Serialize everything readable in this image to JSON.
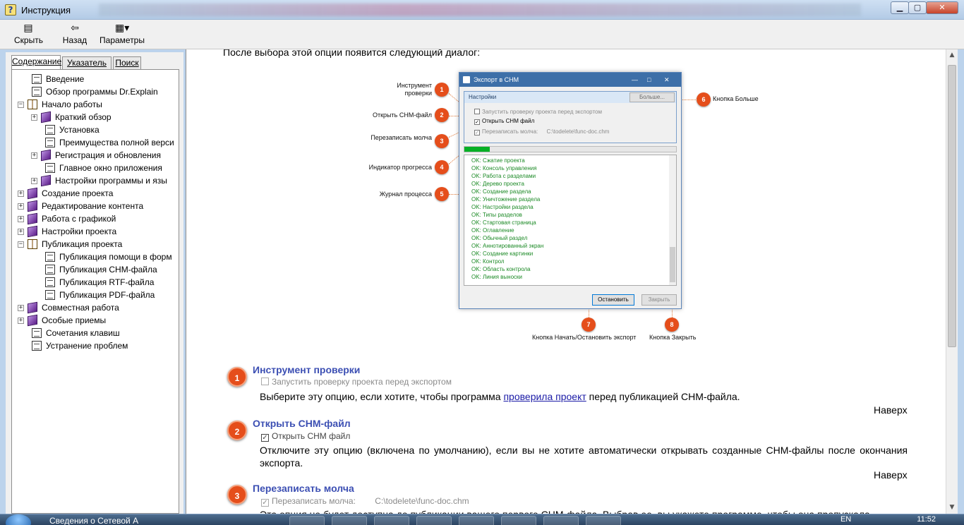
{
  "window": {
    "title": "Инструкция"
  },
  "toolbar": {
    "hide": "Скрыть",
    "back": "Назад",
    "options": "Параметры"
  },
  "tabs": [
    "Содержание",
    "Указатель",
    "Поиск"
  ],
  "tree": [
    {
      "label": "Введение",
      "icon": "page",
      "level": 1,
      "expander": false
    },
    {
      "label": "Обзор программы Dr.Explain",
      "icon": "page",
      "level": 1,
      "expander": false
    },
    {
      "label": "Начало работы",
      "icon": "open-book",
      "level": 0,
      "expander": "−"
    },
    {
      "label": "Краткий обзор",
      "icon": "book",
      "level": 2,
      "expander": "+"
    },
    {
      "label": "Установка",
      "icon": "page",
      "level": 3,
      "expander": false
    },
    {
      "label": "Преимущества полной верси",
      "icon": "page",
      "level": 3,
      "expander": false
    },
    {
      "label": "Регистрация и обновления",
      "icon": "book",
      "level": 2,
      "expander": "+"
    },
    {
      "label": "Главное окно приложения",
      "icon": "page",
      "level": 3,
      "expander": false
    },
    {
      "label": "Настройки программы и язы",
      "icon": "book",
      "level": 2,
      "expander": "+"
    },
    {
      "label": "Создание проекта",
      "icon": "book",
      "level": 0,
      "expander": "+"
    },
    {
      "label": "Редактирование контента",
      "icon": "book",
      "level": 0,
      "expander": "+"
    },
    {
      "label": "Работа с графикой",
      "icon": "book",
      "level": 0,
      "expander": "+"
    },
    {
      "label": "Настройки проекта",
      "icon": "book",
      "level": 0,
      "expander": "+"
    },
    {
      "label": "Публикация проекта",
      "icon": "open-book",
      "level": 0,
      "expander": "−"
    },
    {
      "label": "Публикация помощи в форм",
      "icon": "page",
      "level": 3,
      "expander": false
    },
    {
      "label": "Публикация CHM-файла",
      "icon": "page",
      "level": 3,
      "expander": false
    },
    {
      "label": "Публикация RTF-файла",
      "icon": "page",
      "level": 3,
      "expander": false
    },
    {
      "label": "Публикация PDF-файла",
      "icon": "page",
      "level": 3,
      "expander": false
    },
    {
      "label": "Совместная работа",
      "icon": "book",
      "level": 0,
      "expander": "+"
    },
    {
      "label": "Особые приемы",
      "icon": "book",
      "level": 0,
      "expander": "+"
    },
    {
      "label": "Сочетания клавиш",
      "icon": "page",
      "level": 1,
      "expander": false
    },
    {
      "label": "Устранение проблем",
      "icon": "page",
      "level": 1,
      "expander": false
    }
  ],
  "content": {
    "intro": "После выбора этой опции появится следующий диалог:",
    "figure": {
      "dialog_title": "Экспорт в CHM",
      "settings_label": "Настройки",
      "more_button": "Больше...",
      "check_verify": "Запустить проверку проекта перед экспортом",
      "check_open": "Открыть CHM файл",
      "check_overwrite": "Перезаписать молча:",
      "overwrite_path": "C:\\todelete\\func-doc.chm",
      "progress": 0.12,
      "log": [
        "OK: Сжатие проекта",
        "OK: Консоль управления",
        "OK: Работа с разделами",
        "OK: Дерево проекта",
        "OK: Создание раздела",
        "OK: Уничтожение раздела",
        "OK: Настройки раздела",
        "OK: Типы разделов",
        "OK: Стартовая страница",
        "OK: Оглавление",
        "OK: Обычный раздел",
        "OK: Аннотированный экран",
        "OK: Создание картинки",
        "OK: Контрол",
        "OK: Область контрола",
        "OK: Линия выноски"
      ],
      "stop_button": "Остановить",
      "close_button": "Закрыть",
      "callouts": {
        "c1": "Инструмент\nпроверки",
        "c2": "Открыть CHM-файл",
        "c3": "Перезаписать молча",
        "c4": "Индикатор прогресса",
        "c5": "Журнал процесса",
        "c6": "Кнопка Больше",
        "c7": "Кнопка Начать/Остановить экспорт",
        "c8": "Кнопка Закрыть"
      },
      "numbers": [
        "1",
        "2",
        "3",
        "4",
        "5",
        "6",
        "7",
        "8"
      ]
    },
    "sections": [
      {
        "num": "1",
        "title": "Инструмент  проверки",
        "option": "Запустить проверку проекта перед экспортом",
        "text_before": "Выберите эту опцию, если хотите, чтобы программа ",
        "link": "проверила проект",
        "text_after": " перед публикацией CHM-файла.",
        "top": "Наверх"
      },
      {
        "num": "2",
        "title": "Открыть CHM-файл",
        "option": "Открыть CHM файл",
        "text": "Отключите эту опцию (включена по умолчанию), если вы не хотите автоматически открывать созданные CHM-файлы после окончания экспорта.",
        "top": "Наверх"
      },
      {
        "num": "3",
        "title": "Перезаписать молча",
        "option": "Перезаписать молча:",
        "path": "C:\\todelete\\func-doc.chm",
        "text": "Эта опция не будет доступна до публикации вашего первого CHM-файла. Выбрав ее, вы укажете программе, чтобы она пропускала"
      }
    ]
  },
  "taskbar": {
    "label": "Сведения о Сетевой А",
    "lang": "EN",
    "time": "11:52"
  }
}
